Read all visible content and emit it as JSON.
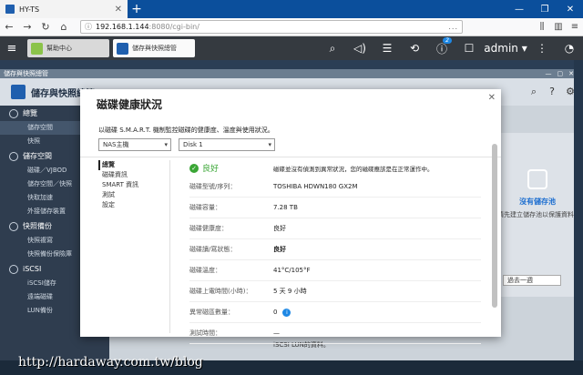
{
  "browser": {
    "tab_title": "HY-TS",
    "new_tab": "+",
    "url_host": "192.168.1.144",
    "url_path": ":8080/cgi-bin/",
    "url_more": "...",
    "win_min": "—",
    "win_max": "❐",
    "win_close": "✕"
  },
  "qts": {
    "tabs": [
      {
        "label": "幫助中心",
        "color": "#8bc34a"
      },
      {
        "label": "儲存與快照總管",
        "color": "#1f5fae"
      }
    ],
    "user": "admin ▾",
    "notification_count": "2"
  },
  "app": {
    "window_title": "儲存與快照總管",
    "name": "儲存與快照總管",
    "sidebar": [
      {
        "section": "總覽",
        "items": [
          "儲存空間",
          "快照"
        ]
      },
      {
        "section": "儲存空間",
        "items": [
          "磁碟／VJBOD",
          "儲存空間／快照",
          "快取加速",
          "外接儲存裝置"
        ]
      },
      {
        "section": "快照備份",
        "items": [
          "快照複寫",
          "快照備份保險庫"
        ]
      },
      {
        "section": "iSCSI",
        "items": [
          "iSCSI儲存",
          "遠端磁碟",
          "LUN備份"
        ]
      }
    ],
    "right_card": {
      "title": "沒有儲存池",
      "text": "請先建立儲存池以保護資料",
      "select": "過去一週"
    },
    "bottom_text": "iSCSI LUN的資料。"
  },
  "dialog": {
    "title": "磁碟健康狀況",
    "close": "✕",
    "description": "以磁碟 S.M.A.R.T. 機制監控磁碟的健康度、溫度與使用狀況。",
    "device_select": "NAS主機",
    "disk_select": "Disk 1",
    "nav": [
      "總覽",
      "磁碟資訊",
      "SMART 資訊",
      "測試",
      "設定"
    ],
    "status_label": "良好",
    "status_desc": "磁碟並沒有偵測到異常狀況，您的磁碟應該是在正常運作中。",
    "rows": [
      {
        "key": "磁碟型號/序列：",
        "value": "TOSHIBA HDWN180 GX2M",
        "bold": false,
        "info": false
      },
      {
        "key": "磁碟容量：",
        "value": "7.28 TB",
        "bold": false,
        "info": false
      },
      {
        "key": "磁碟健康度：",
        "value": "良好",
        "bold": false,
        "info": false
      },
      {
        "key": "磁碟讀/寫狀態：",
        "value": "良好",
        "bold": true,
        "info": false
      },
      {
        "key": "磁碟溫度：",
        "value": "41°C/105°F",
        "bold": false,
        "info": false
      },
      {
        "key": "磁碟上電時間(小時)：",
        "value": "5 天 9 小時",
        "bold": false,
        "info": false
      },
      {
        "key": "異常磁區數量：",
        "value": "0",
        "bold": false,
        "info": true
      },
      {
        "key": "測試時間：",
        "value": "—",
        "bold": false,
        "info": false
      }
    ]
  },
  "watermark": "http://hardaway.com.tw/blog"
}
